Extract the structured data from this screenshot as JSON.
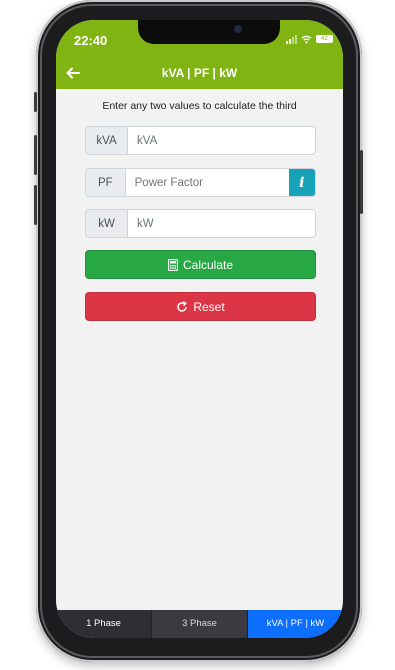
{
  "status_bar": {
    "time": "22:40",
    "battery_level": "42"
  },
  "header": {
    "title": "kVA | PF | kW",
    "back_icon": "arrow-left-icon"
  },
  "form": {
    "instruction": "Enter any two values to calculate the third",
    "kva": {
      "label": "kVA",
      "placeholder": "kVA",
      "value": ""
    },
    "pf": {
      "label": "PF",
      "placeholder": "Power Factor",
      "value": "",
      "info_icon": "info-icon"
    },
    "kw": {
      "label": "kW",
      "placeholder": "kW",
      "value": ""
    }
  },
  "buttons": {
    "calculate": {
      "label": "Calculate",
      "icon": "calculator-icon",
      "color": "#28a745"
    },
    "reset": {
      "label": "Reset",
      "icon": "refresh-icon",
      "color": "#dc3545"
    }
  },
  "tabs": [
    {
      "label": "1 Phase",
      "active": false
    },
    {
      "label": "3 Phase",
      "active": false
    },
    {
      "label": "kVA | PF | kW",
      "active": true
    }
  ],
  "colors": {
    "header": "#80b412",
    "info": "#17a2b8",
    "active_tab": "#0d6efd"
  }
}
